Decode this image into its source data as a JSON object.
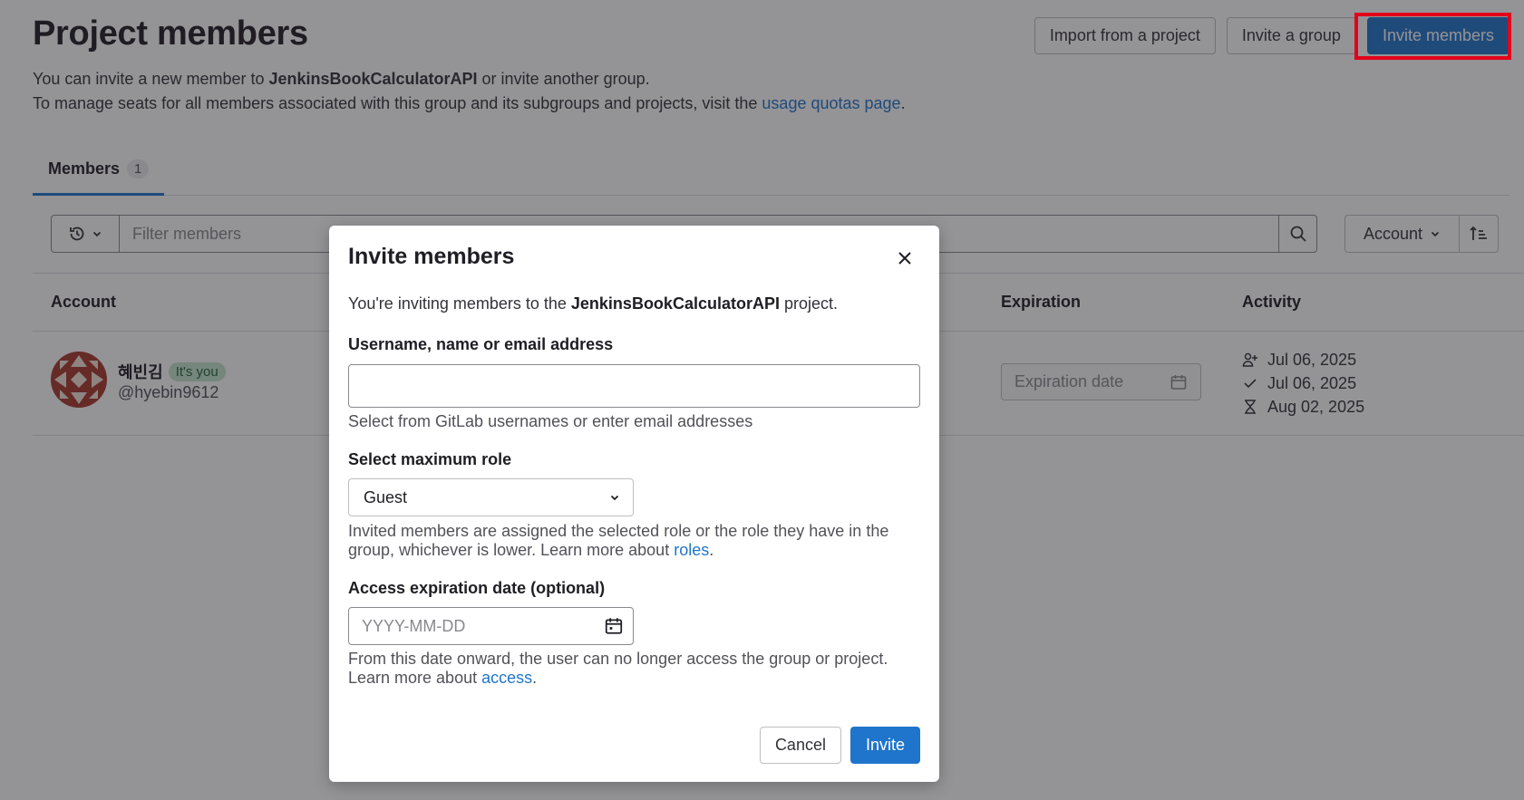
{
  "page": {
    "title": "Project members",
    "description_1_prefix": "You can invite a new member to ",
    "description_1_project": "JenkinsBookCalculatorAPI",
    "description_1_suffix": " or invite another group.",
    "description_2_prefix": "To manage seats for all members associated with this group and its subgroups and projects, visit the ",
    "description_2_link": "usage quotas page",
    "description_2_suffix": "."
  },
  "actions": {
    "import_label": "Import from a project",
    "invite_group_label": "Invite a group",
    "invite_members_label": "Invite members"
  },
  "tabs": [
    {
      "label": "Members",
      "count": "1"
    }
  ],
  "filter": {
    "placeholder": "Filter members",
    "sort_label": "Account"
  },
  "table": {
    "headers": {
      "account": "Account",
      "expiration": "Expiration",
      "activity": "Activity"
    },
    "rows": [
      {
        "name": "혜빈김",
        "badge": "It's you",
        "handle": "@hyebin9612",
        "expiration_placeholder": "Expiration date",
        "activity": {
          "joined": "Jul 06, 2025",
          "last_activity": "Jul 06, 2025",
          "expires": "Aug 02, 2025"
        }
      }
    ]
  },
  "modal": {
    "title": "Invite members",
    "intro_prefix": "You're inviting members to the ",
    "intro_project": "JenkinsBookCalculatorAPI",
    "intro_suffix": " project.",
    "username_label": "Username, name or email address",
    "username_value": "",
    "username_help": "Select from GitLab usernames or enter email addresses",
    "role_label": "Select maximum role",
    "role_value": "Guest",
    "role_help_prefix": "Invited members are assigned the selected role or the role they have in the group, whichever is lower. Learn more about ",
    "role_help_link": "roles",
    "role_help_suffix": ".",
    "expiration_label": "Access expiration date (optional)",
    "expiration_placeholder": "YYYY-MM-DD",
    "expiration_help_prefix": "From this date onward, the user can no longer access the group or project. Learn more about ",
    "expiration_help_link": "access",
    "expiration_help_suffix": ".",
    "cancel_label": "Cancel",
    "invite_label": "Invite"
  },
  "colors": {
    "primary": "#1f75cb",
    "highlight": "#e3001b",
    "badge_bg": "#c3e6cd",
    "badge_text": "#24663b"
  },
  "icons": [
    "history-icon",
    "chevron-down-icon",
    "search-icon",
    "sort-ascending-icon",
    "calendar-icon",
    "user-add-icon",
    "check-icon",
    "hourglass-icon",
    "close-icon"
  ]
}
